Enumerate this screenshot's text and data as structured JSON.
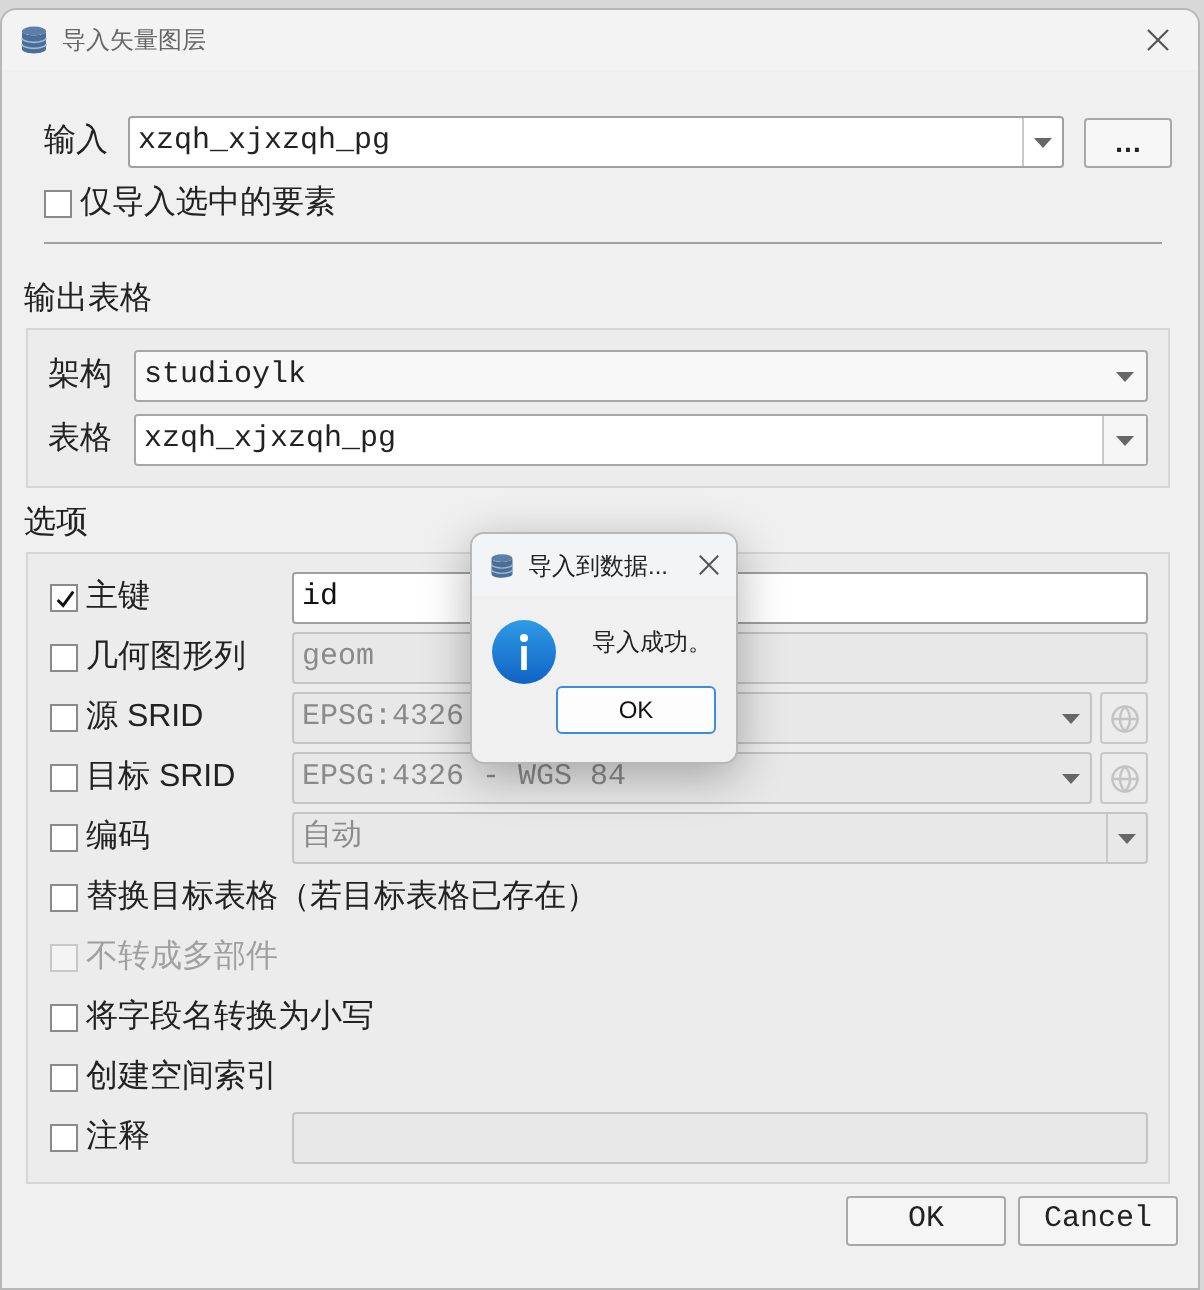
{
  "window": {
    "title": "导入矢量图层"
  },
  "input": {
    "label": "输入",
    "value": "xzqh_xjxzqh_pg",
    "browse": "…"
  },
  "selected_only": {
    "label": "仅导入选中的要素",
    "checked": false
  },
  "output": {
    "title": "输出表格",
    "fields": [
      {
        "label": "架构",
        "value": "studioylk",
        "kind": "combo"
      },
      {
        "label": "表格",
        "value": "xzqh_xjxzqh_pg",
        "kind": "editable-combo"
      }
    ]
  },
  "options": {
    "title": "选项",
    "rows": [
      {
        "kind": "text",
        "label": "主键",
        "checked": true,
        "disabled": false,
        "value": "id",
        "field_enabled": true
      },
      {
        "kind": "text",
        "label": "几何图形列",
        "checked": false,
        "disabled": false,
        "value": "geom",
        "field_enabled": false
      },
      {
        "kind": "crs",
        "label": "源 SRID",
        "checked": false,
        "disabled": false,
        "value": "EPSG:4326",
        "field_enabled": false
      },
      {
        "kind": "crs",
        "label": "目标 SRID",
        "checked": false,
        "disabled": false,
        "value": "EPSG:4326 - WGS 84",
        "field_enabled": false
      },
      {
        "kind": "combo",
        "label": "编码",
        "checked": false,
        "disabled": false,
        "value": "自动",
        "field_enabled": false
      },
      {
        "kind": "plain",
        "label": "替换目标表格（若目标表格已存在）",
        "checked": false,
        "disabled": false
      },
      {
        "kind": "plain",
        "label": "不转成多部件",
        "checked": false,
        "disabled": true
      },
      {
        "kind": "plain",
        "label": "将字段名转换为小写",
        "checked": false,
        "disabled": false
      },
      {
        "kind": "plain",
        "label": "创建空间索引",
        "checked": false,
        "disabled": false
      },
      {
        "kind": "text",
        "label": "注释",
        "checked": false,
        "disabled": false,
        "field_enabled": false
      }
    ]
  },
  "buttons": [
    "OK",
    "Cancel"
  ],
  "message_box": {
    "title": "导入到数据...",
    "message": "导入成功。",
    "button": "OK"
  }
}
